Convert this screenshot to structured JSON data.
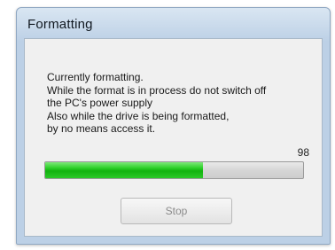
{
  "window": {
    "title": "Formatting"
  },
  "message": {
    "lines": [
      "Currently formatting.",
      "While the format is in process do not switch off",
      "the PC's power supply",
      "Also while the drive is being formatted,",
      "by no means access it."
    ]
  },
  "progress": {
    "percent_label": "98",
    "fill_fraction": 0.61,
    "fill_color": "#1ec31b"
  },
  "buttons": {
    "stop_label": "Stop"
  }
}
